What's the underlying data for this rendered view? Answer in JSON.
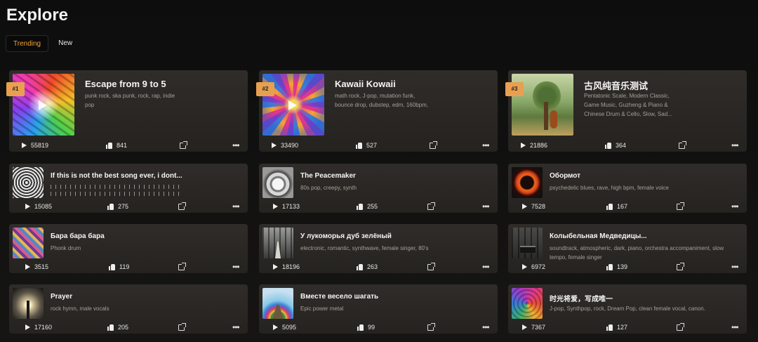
{
  "page_title": "Explore",
  "tabs": [
    {
      "label": "Trending",
      "active": true
    },
    {
      "label": "New",
      "active": false
    }
  ],
  "colors": {
    "accent": "#f3a23a",
    "rank_badge": "#e8a050",
    "card_bg": "#2c2a27"
  },
  "featured": [
    {
      "rank": "#1",
      "title": "Escape from 9 to 5",
      "tags": "punk rock, ska punk, rock, rap, indie pop",
      "plays": "55819",
      "likes": "841",
      "cover": "psychedelic-rainbow-art"
    },
    {
      "rank": "#2",
      "title": "Kawaii Kowaii",
      "tags": "math rock, J-pop, mutation funk, bounce drop, dubstep, edm, 160bpm,",
      "plays": "33490",
      "likes": "527",
      "cover": "kaleidoscope-mandala-art"
    },
    {
      "rank": "#3",
      "title": "古风纯音乐测试",
      "tags": "Pentatonic Scale, Modern Classic, Game Music, Guzheng & Piano & Chinese Drum & Cello, Slow, Sad...",
      "plays": "21886",
      "likes": "364",
      "cover": "cello-under-tree-art"
    }
  ],
  "songs": [
    {
      "title": "If this is not the best song ever, i dont...",
      "tags": "",
      "plays": "15085",
      "likes": "275",
      "cover": "spiral-sketch-art",
      "waveform": true
    },
    {
      "title": "The Peacemaker",
      "tags": "80s pop, creepy, synth",
      "plays": "17133",
      "likes": "255",
      "cover": "bird-sketch-art"
    },
    {
      "title": "Обормот",
      "tags": "psychedelic blues, rave, high bpm, female voice",
      "plays": "7528",
      "likes": "167",
      "cover": "fire-ring-figure-art"
    },
    {
      "title": "Бара бара бара",
      "tags": "Phonk drum",
      "plays": "3515",
      "likes": "119",
      "cover": "colorful-pattern-art"
    },
    {
      "title": "У лукоморья дуб зелёный",
      "tags": "electronic, romantic, synthwave, female singer, 80's",
      "plays": "18196",
      "likes": "263",
      "cover": "forest-path-art"
    },
    {
      "title": "Колыбельная Медведицы...",
      "tags": "soundtrack, atmospheric, dark, piano, orchestra accompaniment, slow tempo, female singer",
      "plays": "6972",
      "likes": "139",
      "cover": "piano-in-forest-art"
    },
    {
      "title": "Prayer",
      "tags": "rock hymn, male vocals",
      "plays": "17160",
      "likes": "205",
      "cover": "glowing-tree-art"
    },
    {
      "title": "Вместе весело шагать",
      "tags": "Epic power metal",
      "plays": "5095",
      "likes": "99",
      "cover": "rainbow-road-art"
    },
    {
      "title": "时光将爱，写成唯一",
      "tags": "J-pop, Synthpop, rock, Dream Pop, clean female vocal, canon.",
      "plays": "7367",
      "likes": "127",
      "cover": "swirl-rainbow-art"
    }
  ]
}
